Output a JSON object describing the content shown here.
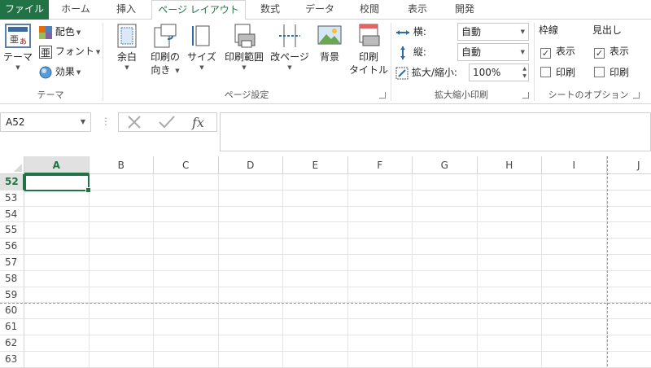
{
  "tabs": [
    "ファイル",
    "ホーム",
    "挿入",
    "ページ レイアウト",
    "数式",
    "データ",
    "校閲",
    "表示",
    "開発"
  ],
  "active_tab": "ページ レイアウト",
  "ribbon": {
    "theme": {
      "themes_label": "テーマ",
      "colors_label": "配色",
      "fonts_label": "フォント",
      "effects_label": "効果",
      "group_label": "テーマ"
    },
    "page_setup": {
      "margins_label": "余白",
      "orientation_label_1": "印刷の",
      "orientation_label_2": "向き",
      "size_label": "サイズ",
      "print_area_label": "印刷範囲",
      "breaks_label": "改ページ",
      "background_label": "背景",
      "print_titles_label_1": "印刷",
      "print_titles_label_2": "タイトル",
      "group_label": "ページ設定"
    },
    "scale_to_fit": {
      "width_label": "横:",
      "width_value": "自動",
      "height_label": "縦:",
      "height_value": "自動",
      "scale_label": "拡大/縮小:",
      "scale_value": "100%",
      "group_label": "拡大縮小印刷"
    },
    "sheet_options": {
      "gridlines_title": "枠線",
      "headings_title": "見出し",
      "gridlines_view_label": "表示",
      "gridlines_view_checked": true,
      "gridlines_print_label": "印刷",
      "gridlines_print_checked": false,
      "headings_view_label": "表示",
      "headings_view_checked": true,
      "headings_print_label": "印刷",
      "headings_print_checked": false,
      "group_label": "シートのオプション"
    }
  },
  "formula_bar": {
    "name_box": "A52",
    "formula": ""
  },
  "sheet": {
    "columns": [
      "A",
      "B",
      "C",
      "D",
      "E",
      "F",
      "G",
      "H",
      "I",
      "J"
    ],
    "rows": [
      "52",
      "53",
      "54",
      "55",
      "56",
      "57",
      "58",
      "59",
      "60",
      "61",
      "62",
      "63"
    ],
    "selected_cell": "A52",
    "accent": "#217346"
  }
}
